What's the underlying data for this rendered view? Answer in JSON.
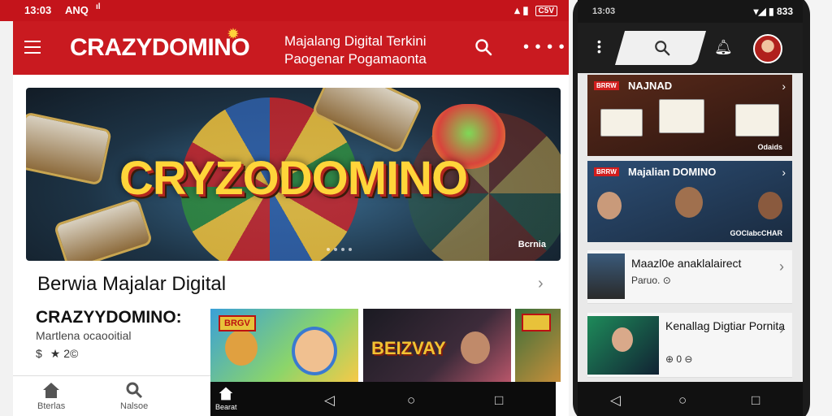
{
  "status_left": {
    "time": "13:03",
    "extra": "ANQ",
    "dots": "ıl"
  },
  "status_right": {
    "icons": "▴ ▮",
    "battery": "C5V"
  },
  "appbar": {
    "brand": "CRAZYDOMINO",
    "subtitle_line1": "Majalang Digital Terkini",
    "subtitle_line2": "Paogenar Pogamaonta"
  },
  "hero": {
    "title": "CRYZODOMINO",
    "caption": "Bcrnia"
  },
  "section": {
    "title": "Berwia Majalar Digital"
  },
  "featured": {
    "title": "CRAZYYDOMINO:",
    "subtitle": "Martlena ocaooitial",
    "meta_a": "$",
    "meta_b": "★ 2©"
  },
  "thumbs": [
    {
      "tag": "BRGV"
    },
    {
      "big": "BEIZVAY"
    },
    {
      "tag": ""
    }
  ],
  "bottom_nav": [
    {
      "label": "Bterlas"
    },
    {
      "label": "Nalsoe"
    }
  ],
  "system_nav": {
    "home_label": "Bearat"
  },
  "right_phone": {
    "status_time": "13:03",
    "status_right": "▾◢ ▮ 833",
    "cards": [
      {
        "tag": "BRRW",
        "headline": "NAJNAD",
        "caption": "Odaids"
      },
      {
        "tag": "BRRW",
        "headline": "Majalian DOMINO",
        "caption": "GOCIabcCHAR"
      }
    ],
    "rows": [
      {
        "title": "Maazl0e anaklalairect",
        "meta": "Paruo. ⊙"
      },
      {
        "title": "Kenallag Digtiar Pornita",
        "meta": "⊕ 0 ⊖"
      }
    ]
  },
  "colors": {
    "brand_red": "#c91a20",
    "hero_gold": "#ffd53a"
  }
}
